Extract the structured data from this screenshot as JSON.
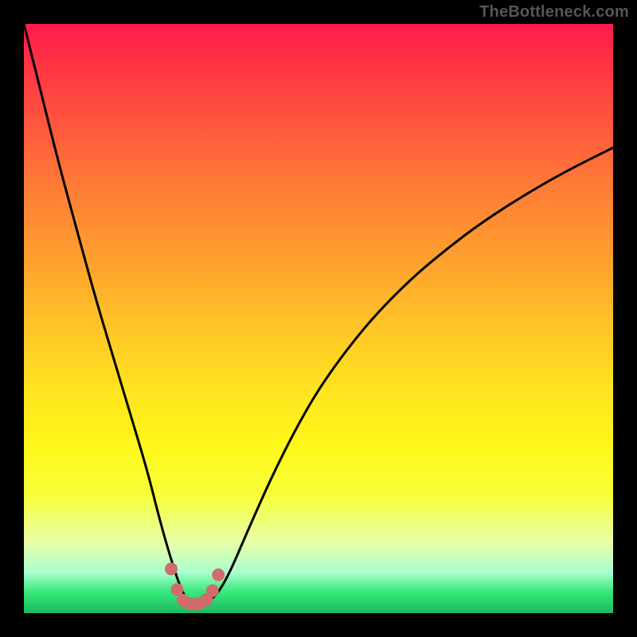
{
  "watermark": "TheBottleneck.com",
  "chart_data": {
    "type": "line",
    "title": "",
    "xlabel": "",
    "ylabel": "",
    "xlim": [
      0,
      100
    ],
    "ylim": [
      0,
      100
    ],
    "grid": false,
    "series": [
      {
        "name": "curve",
        "color": "#000000",
        "x": [
          0,
          3,
          6,
          9,
          12,
          15,
          18,
          21,
          23,
          25,
          26.5,
          27.5,
          28.5,
          30,
          31.5,
          33,
          35,
          38,
          42,
          46,
          50,
          55,
          60,
          66,
          72,
          78,
          85,
          92,
          100
        ],
        "y": [
          100,
          88,
          76,
          65,
          54,
          44,
          34,
          24,
          16,
          9,
          4.5,
          2.5,
          1.8,
          1.5,
          2.1,
          3.5,
          7,
          14,
          23,
          31,
          38,
          45,
          51,
          57,
          62,
          66.5,
          71,
          75,
          79
        ]
      },
      {
        "name": "trough-markers",
        "color": "#cf6d6d",
        "x": [
          25.0,
          26.0,
          27.0,
          28.0,
          29.0,
          30.0,
          31.0,
          32.0,
          33.0
        ],
        "y": [
          7.5,
          4.0,
          2.2,
          1.6,
          1.5,
          1.7,
          2.3,
          3.8,
          6.5
        ]
      }
    ]
  }
}
